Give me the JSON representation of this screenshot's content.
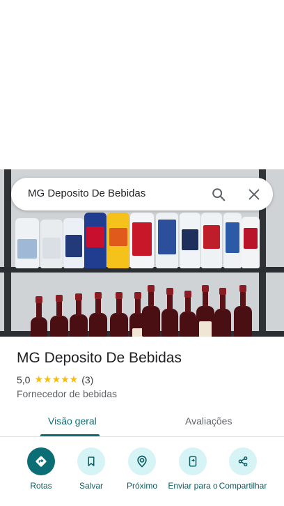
{
  "search": {
    "query": "MG Deposito De Bebidas"
  },
  "place": {
    "name": "MG Deposito De Bebidas",
    "rating": "5,0",
    "stars": "★★★★★",
    "review_count": "(3)",
    "category": "Fornecedor de bebidas"
  },
  "tabs": [
    {
      "label": "Visão geral",
      "active": true
    },
    {
      "label": "Avaliações",
      "active": false
    }
  ],
  "actions": [
    {
      "label": "Rotas",
      "icon": "directions-icon"
    },
    {
      "label": "Salvar",
      "icon": "bookmark-icon"
    },
    {
      "label": "Próximo",
      "icon": "nearby-icon"
    },
    {
      "label": "Enviar para o",
      "icon": "send-to-phone-icon"
    },
    {
      "label": "Compartilhar",
      "icon": "share-icon"
    }
  ],
  "colors": {
    "accent": "#0b6e74",
    "accent_light": "#d6f3f6",
    "star": "#fbbc04"
  }
}
